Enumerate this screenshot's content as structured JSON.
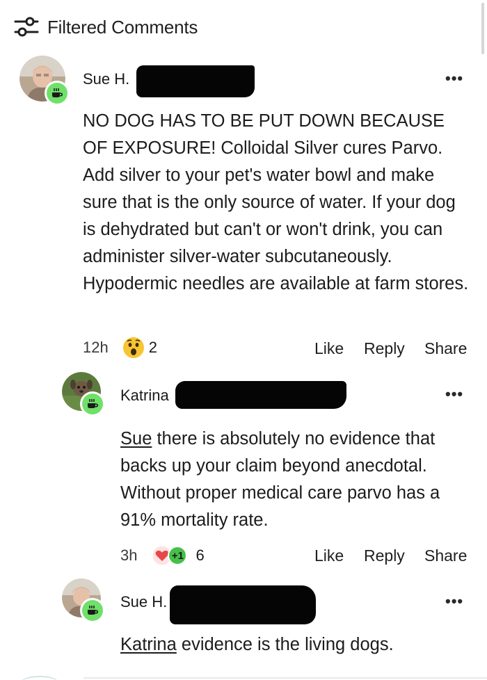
{
  "header": {
    "title": "Filtered Comments"
  },
  "comments": [
    {
      "author": "Sue H.",
      "text": "NO DOG HAS TO BE PUT DOWN BECAUSE OF EXPOSURE! Colloidal Silver cures Parvo. Add silver to your pet's water bowl and make sure that is the only source of water. If your dog is dehydrated but can't or won't drink, you can administer silver-water subcutaneously. Hypodermic needles are available at farm stores.",
      "time": "12h",
      "reaction_count": "2",
      "like": "Like",
      "reply": "Reply",
      "share": "Share",
      "more": "•••"
    },
    {
      "author": "Katrina",
      "mention": "Sue",
      "text": " there is absolutely no evidence that backs up your claim beyond anecdotal. Without proper medical care parvo has a 91% mortality rate.",
      "time": "3h",
      "badge_plus": "+1",
      "reaction_count": "6",
      "like": "Like",
      "reply": "Reply",
      "share": "Share",
      "more": "•••"
    },
    {
      "author": "Sue H.",
      "mention": "Katrina",
      "text": " evidence is the living dogs.",
      "more": "•••"
    }
  ],
  "colors": {
    "badge_green": "#6fe069",
    "heart_red": "#e8474a",
    "plus_green": "#46c04a"
  },
  "icons": {
    "filter": "filter-sliders-icon",
    "badge": "coffee-cup-icon",
    "reaction_1": "wow-face-icon",
    "reaction_2": "heart-icon"
  }
}
